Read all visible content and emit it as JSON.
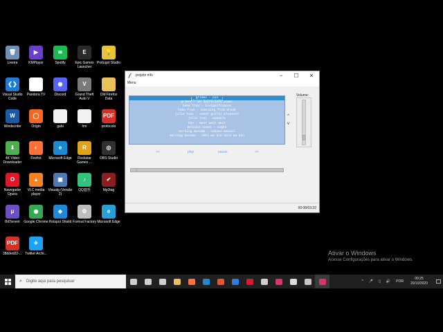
{
  "desktop": {
    "icons": [
      {
        "label": "Lixeira",
        "icon": "recycle-bin-icon",
        "color": "#6f8fb5",
        "glyph": "🗑"
      },
      {
        "label": "KMPlayer",
        "icon": "kmplayer-icon",
        "color": "#6b3fc9",
        "glyph": "▶"
      },
      {
        "label": "Spotify",
        "icon": "spotify-icon",
        "color": "#1db954",
        "glyph": "≋"
      },
      {
        "label": "Epic Games Launcher",
        "icon": "epic-games-icon",
        "color": "#2a2a2a",
        "glyph": "E"
      },
      {
        "label": "Portugol Studio",
        "icon": "lightbulb-icon",
        "color": "#e8c23a",
        "glyph": "💡"
      },
      {
        "label": "Visual Studio Code",
        "icon": "vscode-icon",
        "color": "#1f7bd4",
        "glyph": "❮❯"
      },
      {
        "label": "Pandora TV",
        "icon": "document-icon",
        "color": "#ffffff",
        "glyph": ""
      },
      {
        "label": "Discord",
        "icon": "discord-icon",
        "color": "#5865f2",
        "glyph": "◉"
      },
      {
        "label": "Grand Theft Auto V",
        "icon": "gta-icon",
        "color": "#7a7a7a",
        "glyph": "V"
      },
      {
        "label": "Old Firefox Data",
        "icon": "folder-icon",
        "color": "#e9c15a",
        "glyph": ""
      },
      {
        "label": "Windscribe",
        "icon": "windscribe-icon",
        "color": "#1a5aa8",
        "glyph": "W"
      },
      {
        "label": "Origin",
        "icon": "origin-icon",
        "color": "#f26a21",
        "glyph": "◯"
      },
      {
        "label": "gabi",
        "icon": "file-icon",
        "color": "#f2f2f2",
        "glyph": ""
      },
      {
        "label": "hm",
        "icon": "file-icon",
        "color": "#f2f2f2",
        "glyph": ""
      },
      {
        "label": "protocolo",
        "icon": "pdf-icon",
        "color": "#d93025",
        "glyph": "PDF"
      },
      {
        "label": "4K Video Downloader",
        "icon": "4k-downloader-icon",
        "color": "#4caf50",
        "glyph": "⬇"
      },
      {
        "label": "Firefox",
        "icon": "firefox-icon",
        "color": "#ff7139",
        "glyph": "◐"
      },
      {
        "label": "Microsoft Edge",
        "icon": "edge-icon",
        "color": "#1b8ad3",
        "glyph": "e"
      },
      {
        "label": "Rockstar Games ...",
        "icon": "rockstar-icon",
        "color": "#e0a21b",
        "glyph": "R"
      },
      {
        "label": "OBS Studio",
        "icon": "obs-icon",
        "color": "#303030",
        "glyph": "◎"
      },
      {
        "label": "Navegador Opera",
        "icon": "opera-icon",
        "color": "#e0162b",
        "glyph": "O"
      },
      {
        "label": "VLC media player",
        "icon": "vlc-icon",
        "color": "#f58220",
        "glyph": "▲"
      },
      {
        "label": "Visualg (Versão 2)",
        "icon": "visualg-icon",
        "color": "#4d7ab0",
        "glyph": "▣"
      },
      {
        "label": "QQ音乐",
        "icon": "qq-music-icon",
        "color": "#31c27c",
        "glyph": "♪"
      },
      {
        "label": "Mp3tag",
        "icon": "mp3tag-icon",
        "color": "#8b1e1e",
        "glyph": "✔"
      },
      {
        "label": "BitTorrent",
        "icon": "bittorrent-icon",
        "color": "#6c4fc4",
        "glyph": "μ"
      },
      {
        "label": "Google Chrome",
        "icon": "chrome-icon",
        "color": "#34a853",
        "glyph": "◉"
      },
      {
        "label": "Hotspot Shield",
        "icon": "hotspot-shield-icon",
        "color": "#1f88d9",
        "glyph": "◈"
      },
      {
        "label": "Formut Factory",
        "icon": "format-factory-icon",
        "color": "#bdbdbd",
        "glyph": "⚙"
      },
      {
        "label": "Microsoft Edge",
        "icon": "edge-new-icon",
        "color": "#28a0d6",
        "glyph": "e"
      },
      {
        "label": "38dded22-...",
        "icon": "pdf-icon",
        "color": "#d93025",
        "glyph": "PDF"
      },
      {
        "label": "Twitter Archi...",
        "icon": "twitter-icon",
        "color": "#1da1f2",
        "glyph": "✈"
      }
    ]
  },
  "window": {
    "title": "projeto mfs",
    "menu_label": "Menu",
    "minimize_glyph": "–",
    "maximize_glyph": "☐",
    "close_glyph": "✕",
    "playlist": [
      "grimes - pin",
      "grimes - we appreciate power",
      "hebe fran - insignificance",
      "hobo fran - learning from drunk",
      "jolin tsai - sweet guilty pleasure",
      "jolin tsai - womanly",
      "kun - wait wait wait",
      "melodie sweet - sugho",
      "morning musume - sekoku manual",
      "morning musume - ikkl wa koo sore wa koo"
    ],
    "selected_index": 0,
    "volume_label": "Volume:",
    "volume_level": 0.1,
    "controls": {
      "prev": "<<",
      "play": "play",
      "pause": "pause",
      "next": ">>"
    },
    "progress_handle": "|||",
    "progress_fraction": 0.03,
    "time": "00:08/03:32"
  },
  "watermark": {
    "line1": "Ativar o Windows",
    "line2": "Acesse Configurações para ativar o Windows."
  },
  "taskbar": {
    "search_placeholder": "Digite aqui para pesquisar",
    "apps": [
      {
        "icon": "cortana-icon",
        "color": "#cfcfcf"
      },
      {
        "icon": "task-view-icon",
        "color": "#cfcfcf"
      },
      {
        "icon": "store-icon",
        "color": "#cfcfcf"
      },
      {
        "icon": "file-explorer-icon",
        "color": "#e9c15a"
      },
      {
        "icon": "firefox-icon",
        "color": "#ff7139"
      },
      {
        "icon": "edge-icon",
        "color": "#1b8ad3"
      },
      {
        "icon": "office-icon",
        "color": "#e4572e"
      },
      {
        "icon": "bluetooth-icon",
        "color": "#2b7de9"
      },
      {
        "icon": "opera-icon",
        "color": "#e0162b"
      },
      {
        "icon": "settings-icon",
        "color": "#cfcfcf"
      },
      {
        "icon": "pdf-icon",
        "color": "#d9346b"
      },
      {
        "icon": "steam-icon",
        "color": "#dddddd"
      },
      {
        "icon": "media-icon",
        "color": "#c8c8c8"
      },
      {
        "icon": "pdf-app-icon",
        "color": "#d9346b"
      }
    ],
    "tray": {
      "expand_glyph": "^",
      "mic_glyph": "🎤",
      "network_glyph": "▯",
      "volume_glyph": "🔊",
      "language": "POR",
      "time": "09:25",
      "date": "20/10/2020"
    }
  }
}
